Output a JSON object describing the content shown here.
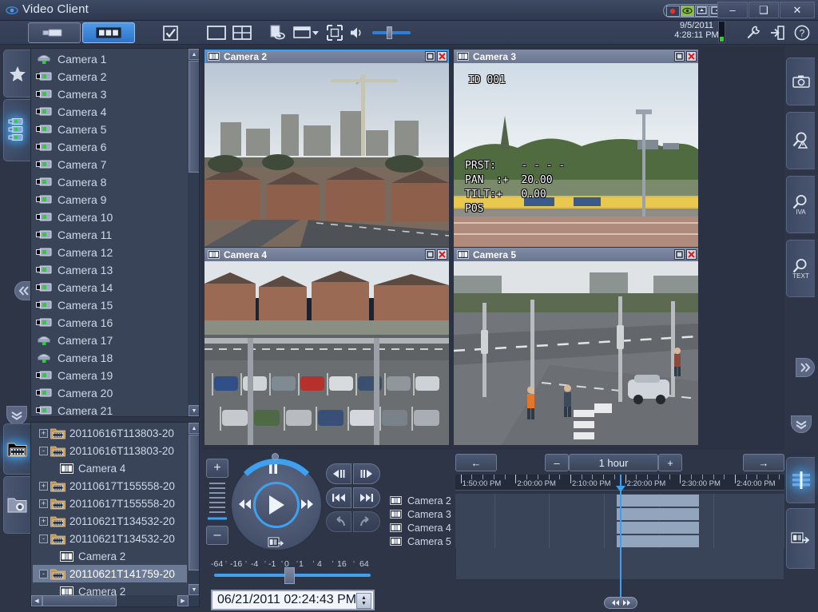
{
  "window": {
    "title": "Video Client",
    "app_icon": "eye-icon",
    "minimize_label": "–",
    "maximize_label": "❑",
    "close_label": "✕",
    "date": "9/5/2011",
    "time": "4:28:11 PM",
    "tray_icons": [
      "record-status-icon",
      "eye-status-icon",
      "monitor-status-icon",
      "export-status-icon"
    ]
  },
  "toolbar": {
    "live_mode_label": "live-mode-icon",
    "playback_mode_label": "playback-mode-icon",
    "buttons": [
      {
        "name": "checkbox-toggle",
        "icon": "checkbox-checked-icon"
      },
      {
        "name": "layout-single",
        "icon": "single-pane-icon"
      },
      {
        "name": "layout-quad",
        "icon": "quad-pane-icon"
      },
      {
        "name": "instant-playback",
        "icon": "document-eye-icon"
      },
      {
        "name": "window-menu",
        "icon": "window-dropdown-icon"
      },
      {
        "name": "fullscreen",
        "icon": "fullscreen-icon"
      },
      {
        "name": "audio",
        "icon": "speaker-icon"
      }
    ],
    "volume_value": 50,
    "settings_icon": "wrench-icon",
    "logout_icon": "logout-icon",
    "help_icon": "help-icon"
  },
  "left_rail": {
    "favorites_icon": "star-icon",
    "cameras_icon": "camera-list-icon",
    "recordings_icon": "folder-recordings-icon",
    "exports_icon": "folder-export-icon",
    "collapse_left_icon": "double-chevron-left-icon",
    "collapse_down_icon": "double-chevron-down-icon"
  },
  "camera_list": {
    "cameras": [
      {
        "label": "Camera 1",
        "type": "dome"
      },
      {
        "label": "Camera 2",
        "type": "box"
      },
      {
        "label": "Camera 3",
        "type": "box"
      },
      {
        "label": "Camera 4",
        "type": "box"
      },
      {
        "label": "Camera 5",
        "type": "box"
      },
      {
        "label": "Camera 6",
        "type": "box"
      },
      {
        "label": "Camera 7",
        "type": "box"
      },
      {
        "label": "Camera 8",
        "type": "box"
      },
      {
        "label": "Camera 9",
        "type": "box"
      },
      {
        "label": "Camera 10",
        "type": "box"
      },
      {
        "label": "Camera 11",
        "type": "box"
      },
      {
        "label": "Camera 12",
        "type": "box"
      },
      {
        "label": "Camera 13",
        "type": "box"
      },
      {
        "label": "Camera 14",
        "type": "box"
      },
      {
        "label": "Camera 15",
        "type": "box"
      },
      {
        "label": "Camera 16",
        "type": "box"
      },
      {
        "label": "Camera 17",
        "type": "dome"
      },
      {
        "label": "Camera 18",
        "type": "dome"
      },
      {
        "label": "Camera 19",
        "type": "box"
      },
      {
        "label": "Camera 20",
        "type": "box"
      },
      {
        "label": "Camera 21",
        "type": "box"
      }
    ]
  },
  "recordings_tree": {
    "rows": [
      {
        "label": "20110616T113803-20",
        "kind": "folder",
        "indent": 0,
        "expander": "+",
        "selected": false
      },
      {
        "label": "20110616T113803-20",
        "kind": "folder",
        "indent": 0,
        "expander": "-",
        "selected": false
      },
      {
        "label": "Camera 4",
        "kind": "camera",
        "indent": 1,
        "expander": "",
        "selected": false
      },
      {
        "label": "20110617T155558-20",
        "kind": "folder",
        "indent": 0,
        "expander": "+",
        "selected": false
      },
      {
        "label": "20110617T155558-20",
        "kind": "folder",
        "indent": 0,
        "expander": "+",
        "selected": false
      },
      {
        "label": "20110621T134532-20",
        "kind": "folder",
        "indent": 0,
        "expander": "+",
        "selected": false
      },
      {
        "label": "20110621T134532-20",
        "kind": "folder",
        "indent": 0,
        "expander": "-",
        "selected": false
      },
      {
        "label": "Camera 2",
        "kind": "camera",
        "indent": 1,
        "expander": "",
        "selected": false
      },
      {
        "label": "20110621T141759-20",
        "kind": "folder",
        "indent": 0,
        "expander": "-",
        "selected": true
      },
      {
        "label": "Camera 2",
        "kind": "camera",
        "indent": 1,
        "expander": "",
        "selected": false
      }
    ]
  },
  "video_panes": [
    {
      "title": "Camera 2",
      "selected": true,
      "scene": "construction",
      "maximize": "□",
      "close": "✕"
    },
    {
      "title": "Camera 3",
      "selected": false,
      "scene": "ptz",
      "maximize": "□",
      "close": "✕",
      "overlay": {
        "id": "ID 001",
        "prst": "PRST:    - - - -",
        "pan": "PAN  :+  20.00",
        "tilt": "TILT:+   0.00",
        "pos": "POS"
      }
    },
    {
      "title": "Camera 4",
      "selected": false,
      "scene": "parking",
      "maximize": "□",
      "close": "✕"
    },
    {
      "title": "Camera 5",
      "selected": false,
      "scene": "street",
      "maximize": "□",
      "close": "✕"
    }
  ],
  "right_rail": {
    "tabs": [
      {
        "name": "snapshot-search",
        "icon": "camera-icon",
        "caption": ""
      },
      {
        "name": "alarm-search",
        "icon": "magnifier-alert-icon",
        "caption": ""
      },
      {
        "name": "iva-search",
        "icon": "magnifier-icon",
        "caption": "IVA"
      },
      {
        "name": "text-search",
        "icon": "magnifier-icon",
        "caption": "TEXT"
      }
    ],
    "timeline_tab_icon": "timeline-icon",
    "export_tab_icon": "film-export-icon",
    "collapse_right_icon": "double-chevron-right-icon",
    "collapse_down_icon": "double-chevron-down-icon"
  },
  "playback": {
    "play_icon": "play-icon",
    "pause_icon": "pause-icon",
    "rewind_icon": "rewind-icon",
    "forward_icon": "fast-forward-icon",
    "frame_icon": "frame-step-icon",
    "zoom_in_label": "+",
    "zoom_out_label": "–",
    "step_back_icon": "step-back-icon",
    "step_forward_icon": "step-forward-icon",
    "prev_clip_icon": "skip-back-icon",
    "next_clip_icon": "skip-forward-icon",
    "undo_icon": "undo-icon",
    "redo_icon": "redo-icon",
    "speed_labels": [
      "-64",
      "-16",
      "-4",
      "-1",
      "0",
      "1",
      "4",
      "16",
      "64"
    ],
    "speed_value": 0,
    "timestamp": "06/21/2011 02:24:43 PM",
    "spinner_up": "▲",
    "spinner_down": "▼"
  },
  "timeline": {
    "prev_icon": "←",
    "next_icon": "→",
    "zoom_out_label": "–",
    "zoom_in_label": "+",
    "range_label": "1 hour",
    "tick_labels": [
      "1:50:00 PM",
      "2:00:00 PM",
      "2:10:00 PM",
      "2:20:00 PM",
      "2:30:00 PM",
      "2:40:00 PM"
    ],
    "rows": [
      {
        "label": "Camera 2",
        "segment_start_pct": 49,
        "segment_width_pct": 25
      },
      {
        "label": "Camera 3",
        "segment_start_pct": 49,
        "segment_width_pct": 25
      },
      {
        "label": "Camera 4",
        "segment_start_pct": 49,
        "segment_width_pct": 25
      },
      {
        "label": "Camera 5",
        "segment_start_pct": 49,
        "segment_width_pct": 25
      }
    ],
    "playhead_pct": 50,
    "playhead_grip_left_icon": "⏪",
    "playhead_grip_right_icon": "⏩"
  },
  "colors": {
    "accent": "#3fa0f0",
    "panel_bg": "#3a4459",
    "window_bg": "#2d3547",
    "header_bg": "#6a7690",
    "segment": "#93a4bd",
    "text": "#cfd8e8",
    "close_red": "#cc2222",
    "led_green": "#2ad32a"
  }
}
